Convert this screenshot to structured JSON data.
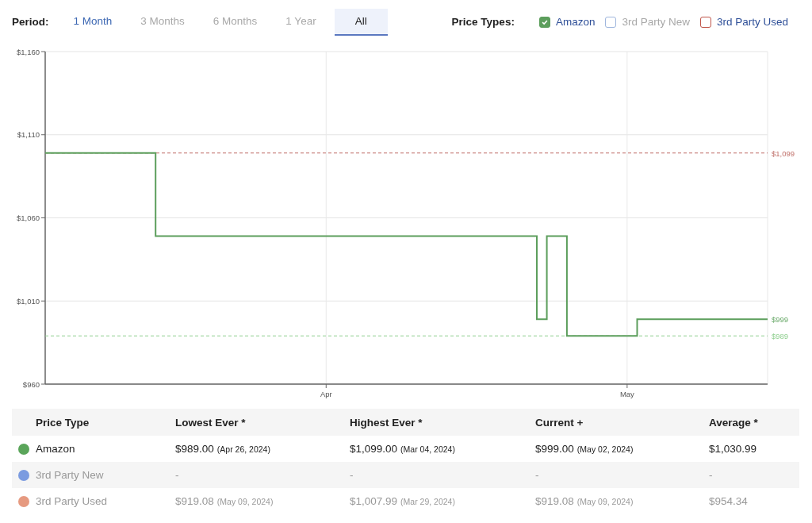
{
  "period": {
    "label": "Period:",
    "tabs": [
      {
        "label": "1 Month",
        "selected": false,
        "disabled": false
      },
      {
        "label": "3 Months",
        "selected": false,
        "disabled": true
      },
      {
        "label": "6 Months",
        "selected": false,
        "disabled": true
      },
      {
        "label": "1 Year",
        "selected": false,
        "disabled": true
      },
      {
        "label": "All",
        "selected": true,
        "disabled": false
      }
    ]
  },
  "price_types": {
    "label": "Price Types:",
    "items": [
      {
        "label": "Amazon",
        "checked": true,
        "disabled": false,
        "color": "#5c9e5c"
      },
      {
        "label": "3rd Party New",
        "checked": false,
        "disabled": true,
        "color": "#9fb6dd"
      },
      {
        "label": "3rd Party Used",
        "checked": false,
        "disabled": false,
        "color": "#c0564b"
      }
    ]
  },
  "chart": {
    "chart_data": {
      "type": "line",
      "x": [
        "2024-03-04",
        "2024-03-15",
        "2024-03-15",
        "2024-04-22",
        "2024-04-22",
        "2024-04-23",
        "2024-04-23",
        "2024-04-25",
        "2024-04-25",
        "2024-05-02",
        "2024-05-02",
        "2024-05-15"
      ],
      "series": [
        {
          "color": "#5c9e5c",
          "values": [
            1099,
            1099,
            1049,
            1049,
            999,
            999,
            1049,
            1049,
            989,
            989,
            999,
            999
          ]
        }
      ],
      "xlim": [
        "2024-03-04",
        "2024-05-15"
      ],
      "ylim": [
        960,
        1160
      ],
      "xticks": [
        {
          "value": "2024-04-01",
          "label": "Apr"
        },
        {
          "value": "2024-05-01",
          "label": "May"
        }
      ],
      "yticks": [
        {
          "value": 960,
          "label": "$960"
        },
        {
          "value": 1010,
          "label": "$1,010"
        },
        {
          "value": 1060,
          "label": "$1,060"
        },
        {
          "value": 1110,
          "label": "$1,110"
        },
        {
          "value": 1160,
          "label": "$1,160"
        }
      ],
      "grid": true,
      "ref_lines": [
        {
          "axis": "y",
          "value": 1099,
          "label": "$1,099",
          "color": "#c0706a"
        },
        {
          "axis": "y",
          "value": 989,
          "label": "$989",
          "color": "#8fcf8f"
        }
      ]
    },
    "current_label": {
      "label": "$999",
      "color": "#6aaa6a"
    }
  },
  "table": {
    "columns": [
      "Price Type",
      "Lowest Ever *",
      "Highest Ever *",
      "Current +",
      "Average *"
    ],
    "rows": [
      {
        "name": "Amazon",
        "color": "#5aa55a",
        "disabled": false,
        "lowest": {
          "value": "$989.00",
          "date": "(Apr 26, 2024)"
        },
        "highest": {
          "value": "$1,099.00",
          "date": "(Mar 04, 2024)"
        },
        "current": {
          "value": "$999.00",
          "date": "(May 02, 2024)"
        },
        "average": "$1,030.99"
      },
      {
        "name": "3rd Party New",
        "color": "#7b9be0",
        "disabled": true,
        "lowest": {
          "value": "-"
        },
        "highest": {
          "value": "-"
        },
        "current": {
          "value": "-"
        },
        "average": "-"
      },
      {
        "name": "3rd Party Used",
        "color": "#e69a80",
        "disabled": true,
        "lowest": {
          "value": "$919.08",
          "date": "(May 09, 2024)"
        },
        "highest": {
          "value": "$1,007.99",
          "date": "(Mar 29, 2024)"
        },
        "current": {
          "value": "$919.08",
          "date": "(May 09, 2024)"
        },
        "average": "$954.34"
      }
    ]
  }
}
